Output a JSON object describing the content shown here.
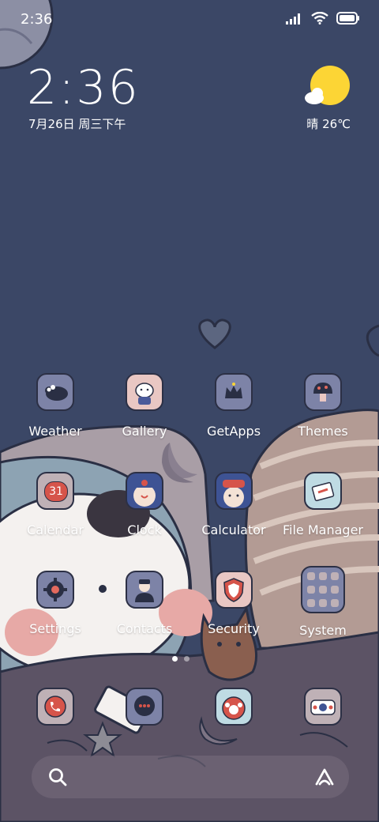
{
  "status_bar": {
    "time": "2:36"
  },
  "clock_widget": {
    "time": "2:36",
    "date": "7月26日 周三下午"
  },
  "weather_widget": {
    "condition": "晴",
    "temperature": "26℃",
    "icon": "sunny-cloud-icon"
  },
  "apps": [
    {
      "label": "Weather",
      "icon": "weather-icon"
    },
    {
      "label": "Gallery",
      "icon": "gallery-icon"
    },
    {
      "label": "GetApps",
      "icon": "getapps-icon"
    },
    {
      "label": "Themes",
      "icon": "themes-icon"
    },
    {
      "label": "Calendar",
      "icon": "calendar-icon",
      "badge": "31"
    },
    {
      "label": "Clock",
      "icon": "clock-icon"
    },
    {
      "label": "Calculator",
      "icon": "calculator-icon"
    },
    {
      "label": "File Manager",
      "icon": "file-manager-icon"
    },
    {
      "label": "Settings",
      "icon": "settings-icon"
    },
    {
      "label": "Contacts",
      "icon": "contacts-icon"
    },
    {
      "label": "Security",
      "icon": "security-icon"
    },
    {
      "label": "System",
      "icon": "system-folder-icon"
    }
  ],
  "dock": [
    {
      "icon": "phone-icon"
    },
    {
      "icon": "messages-icon"
    },
    {
      "icon": "browser-icon"
    },
    {
      "icon": "camera-icon"
    }
  ],
  "page_indicator": {
    "pages": 2,
    "current": 1
  },
  "search_bar": {
    "icon": "search-icon",
    "assistant_icon": "assistant-icon"
  },
  "colors": {
    "sky": "#3b4766",
    "sun": "#fcd535",
    "blanket": "#5c5365"
  }
}
